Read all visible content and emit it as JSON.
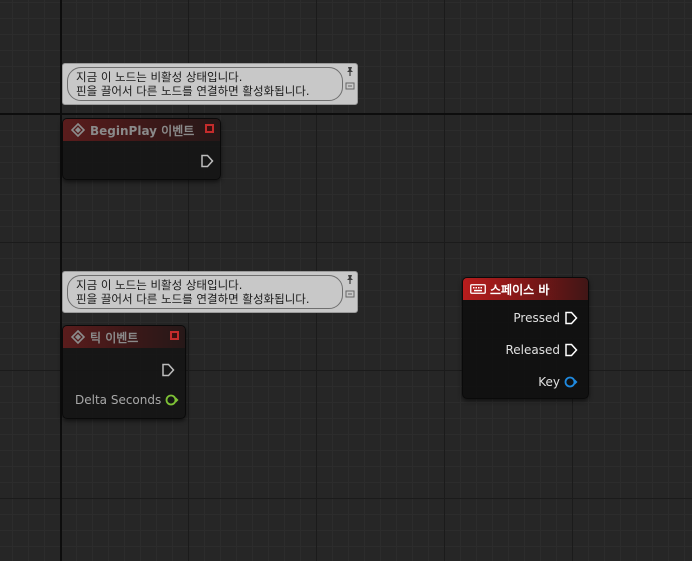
{
  "comments": [
    {
      "line1": "지금 이 노드는 비활성 상태입니다.",
      "line2": "핀을 끌어서 다른 노드를 연결하면 활성화됩니다."
    },
    {
      "line1": "지금 이 노드는 비활성 상태입니다.",
      "line2": "핀을 끌어서 다른 노드를 연결하면 활성화됩니다."
    }
  ],
  "nodes": {
    "begin_play": {
      "title": "BeginPlay 이벤트",
      "icon": "event-diamond-icon"
    },
    "tick": {
      "title": "틱 이벤트",
      "icon": "event-diamond-icon",
      "pins": {
        "delta_seconds": "Delta Seconds"
      }
    },
    "space_bar": {
      "title": "스페이스 바",
      "icon": "keyboard-icon",
      "pins": {
        "pressed": "Pressed",
        "released": "Released",
        "key": "Key"
      }
    }
  },
  "colors": {
    "exec_pin": "#ffffff",
    "float_pin": "#a5f05a",
    "struct_pin": "#0a7ad8",
    "event_header": "#b81d1d"
  }
}
